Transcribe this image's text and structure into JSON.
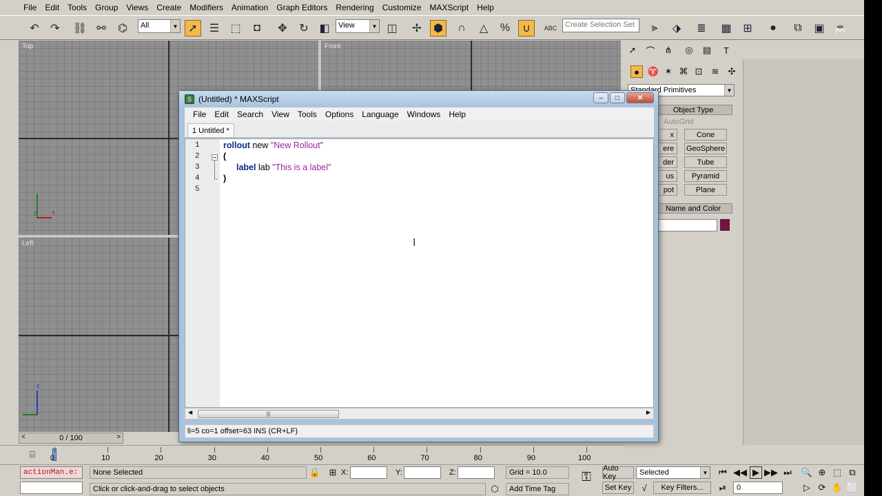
{
  "menubar": [
    "File",
    "Edit",
    "Tools",
    "Group",
    "Views",
    "Create",
    "Modifiers",
    "Animation",
    "Graph Editors",
    "Rendering",
    "Customize",
    "MAXScript",
    "Help"
  ],
  "toolbar": {
    "selection_filter": "All",
    "ref_coord": "View",
    "named_selection_placeholder": "Create Selection Set",
    "snap_label": "ABC"
  },
  "viewports": {
    "top": "Top",
    "front": "Front",
    "left": "Left",
    "axis_y": "y",
    "axis_x": "x",
    "axis_z": "z"
  },
  "command_panel": {
    "category_dropdown": "Standard Primitives",
    "object_type_rollout": "Object Type",
    "autogrid": "AutoGrid",
    "buttons_left_partial": [
      "x",
      "ere",
      "der",
      "us",
      "pot"
    ],
    "buttons_right": [
      "Cone",
      "GeoSphere",
      "Tube",
      "Pyramid",
      "Plane"
    ],
    "name_color_rollout": "Name and Color",
    "color_swatch": "#7a1040"
  },
  "dialog": {
    "title": "(Untitled) * MAXScript",
    "menu": [
      "File",
      "Edit",
      "Search",
      "View",
      "Tools",
      "Options",
      "Language",
      "Windows",
      "Help"
    ],
    "tab": "1 Untitled *",
    "line_numbers": [
      "1",
      "2",
      "3",
      "4",
      "5"
    ],
    "code": {
      "l1_kw": "rollout",
      "l1_mid": " new ",
      "l1_str": "\"New Rollout\"",
      "l2": "(",
      "l3_kw": "label",
      "l3_mid": " lab ",
      "l3_str": "\"This is a label\"",
      "l4": ")"
    },
    "status": "li=5 co=1 offset=63 INS (CR+LF)"
  },
  "timeline": {
    "frame_counter": "0 / 100",
    "ticks": [
      "0",
      "10",
      "20",
      "30",
      "40",
      "50",
      "60",
      "70",
      "80",
      "90",
      "100"
    ]
  },
  "bottom": {
    "script_listener": "actionMan.e:",
    "selection_status": "None Selected",
    "prompt": "Click or click-and-drag to select objects",
    "x_label": "X:",
    "y_label": "Y:",
    "z_label": "Z:",
    "grid": "Grid = 10.0",
    "add_time_tag": "Add Time Tag",
    "auto_key": "Auto Key",
    "set_key": "Set Key",
    "key_mode": "Selected",
    "key_filters": "Key Filters...",
    "frame_value": "0"
  }
}
